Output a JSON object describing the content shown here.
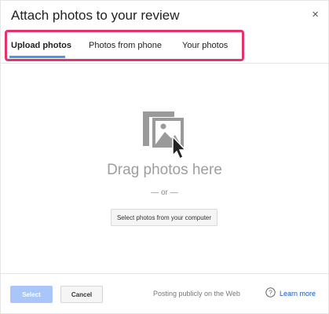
{
  "dialog": {
    "title": "Attach photos to your review",
    "close_glyph": "×"
  },
  "tabs": [
    {
      "label": "Upload photos",
      "active": true
    },
    {
      "label": "Photos from phone",
      "active": false
    },
    {
      "label": "Your photos",
      "active": false
    }
  ],
  "upload": {
    "icon": "image-upload-icon",
    "drag_text": "Drag photos here",
    "or_text": "— or —",
    "select_button": "Select photos from your computer"
  },
  "footer": {
    "select_label": "Select",
    "cancel_label": "Cancel",
    "posting_text": "Posting publicly on the Web",
    "help_icon": "question-circle-icon",
    "learn_more": "Learn more"
  },
  "colors": {
    "highlight": "#e2336b",
    "tab_underline": "#4d90fe",
    "select_button": "#a8c7f8",
    "link": "#1a55b8",
    "drag_text": "#9e9e9e"
  }
}
